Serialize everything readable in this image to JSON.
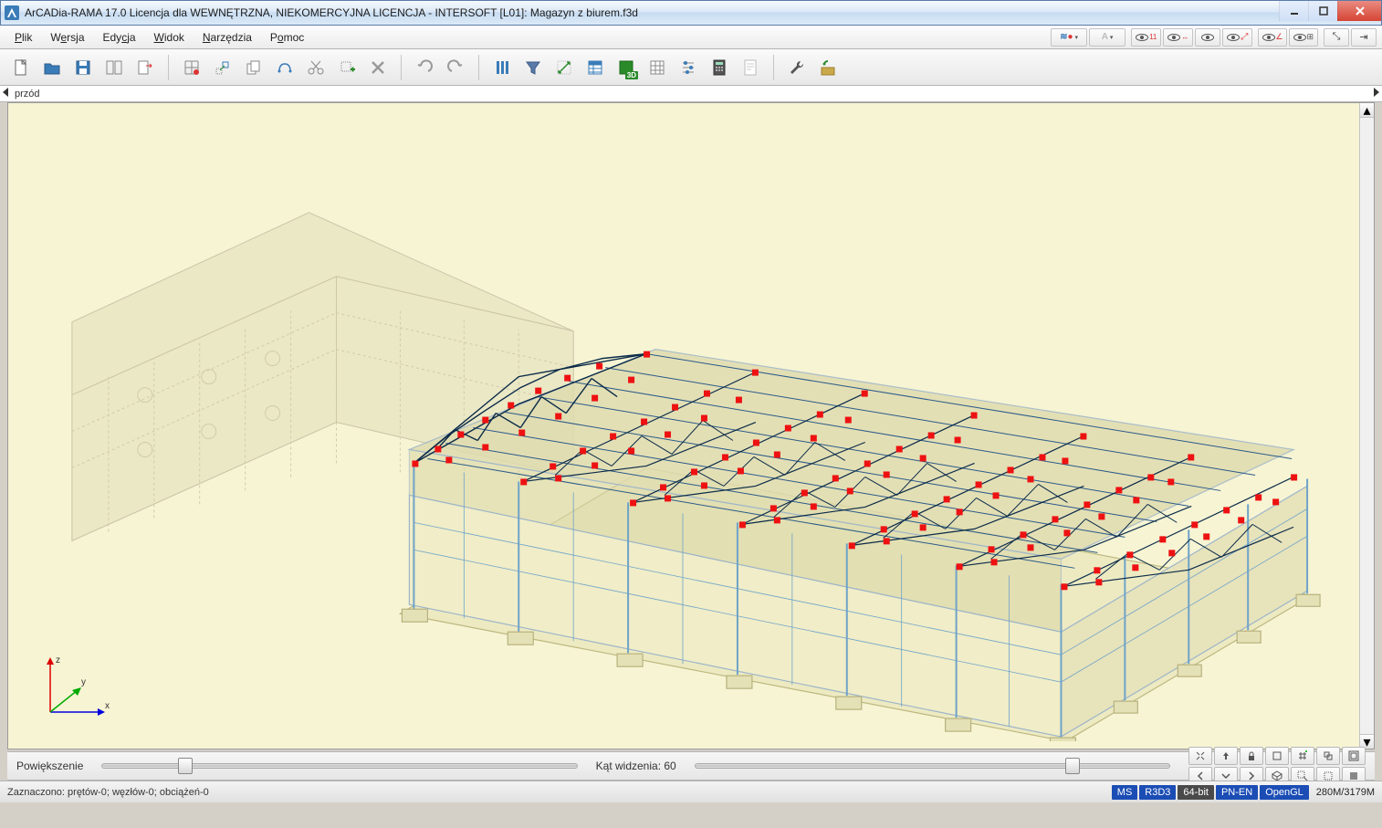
{
  "window": {
    "title": "ArCADia-RAMA 17.0 Licencja dla WEWNĘTRZNA, NIEKOMERCYJNA LICENCJA - INTERSOFT [L01]: Magazyn z biurem.f3d"
  },
  "menu": {
    "items": [
      "Plik",
      "Wersja",
      "Edycja",
      "Widok",
      "Narzędzia",
      "Pomoc"
    ]
  },
  "view_toggles_right": {
    "group1": [
      "layers-toggle",
      "text-style-toggle"
    ],
    "group2": [
      "eye-num-toggle",
      "eye-dim-toggle",
      "eye-plain-toggle",
      "eye-diag-toggle"
    ],
    "group3": [
      "eye-angle-toggle",
      "eye-grid-toggle"
    ],
    "group4": [
      "snap-x-toggle",
      "snap-i-toggle"
    ]
  },
  "toolbar": {
    "buttons": [
      {
        "name": "new-file-button",
        "icon": "doc"
      },
      {
        "name": "open-file-button",
        "icon": "folder"
      },
      {
        "name": "save-button",
        "icon": "save"
      },
      {
        "name": "layout-button",
        "icon": "layout"
      },
      {
        "name": "export-button",
        "icon": "export"
      },
      {
        "sep": true
      },
      {
        "name": "grid-button",
        "icon": "grid"
      },
      {
        "name": "move-node-button",
        "icon": "movenode"
      },
      {
        "name": "copy-button",
        "icon": "copy"
      },
      {
        "name": "mirror-button",
        "icon": "mirror"
      },
      {
        "name": "cut-button",
        "icon": "scissors"
      },
      {
        "name": "add-node-button",
        "icon": "addnode"
      },
      {
        "name": "delete-button",
        "icon": "x"
      },
      {
        "sep": true
      },
      {
        "name": "undo-button",
        "icon": "undo"
      },
      {
        "name": "redo-button",
        "icon": "redo"
      },
      {
        "sep": true
      },
      {
        "name": "columns-button",
        "icon": "columns"
      },
      {
        "name": "filter-button",
        "icon": "funnel"
      },
      {
        "name": "transform-button",
        "icon": "transform"
      },
      {
        "name": "table-button",
        "icon": "table"
      },
      {
        "name": "view3d-button",
        "icon": "cube3d"
      },
      {
        "name": "matrix-button",
        "icon": "matrix"
      },
      {
        "name": "settings-sliders-button",
        "icon": "sliders"
      },
      {
        "name": "calculator-button",
        "icon": "calc"
      },
      {
        "name": "report-button",
        "icon": "report"
      },
      {
        "sep": true
      },
      {
        "name": "tools-button",
        "icon": "wrench"
      },
      {
        "name": "config-button",
        "icon": "config"
      }
    ]
  },
  "ruler": {
    "label": "przód"
  },
  "viewport": {
    "axes": {
      "x": "x",
      "y": "y",
      "z": "z"
    }
  },
  "sliders": {
    "zoom_label": "Powiększenie",
    "fov_label": "Kąt widzenia: 60"
  },
  "nav_cluster": {
    "row1": [
      "zoom-extents-button",
      "up-arrow-button",
      "lock-button",
      "hide-button",
      "grid-plus-button",
      "layers-plus-button",
      "fullscreen-button"
    ],
    "row2": [
      "left-arrow-button",
      "down-arrow-button",
      "right-arrow-button",
      "iso-button",
      "zoom-window-button",
      "wireframe-button",
      "solid-button"
    ]
  },
  "status": {
    "selection": "Zaznaczono: prętów-0; węzłów-0; obciążeń-0",
    "pills": {
      "ms": "MS",
      "r3": "R3D3",
      "b64": "64-bit",
      "pn": "PN-EN",
      "gl": "OpenGL"
    },
    "memory": "280M/3179M"
  }
}
